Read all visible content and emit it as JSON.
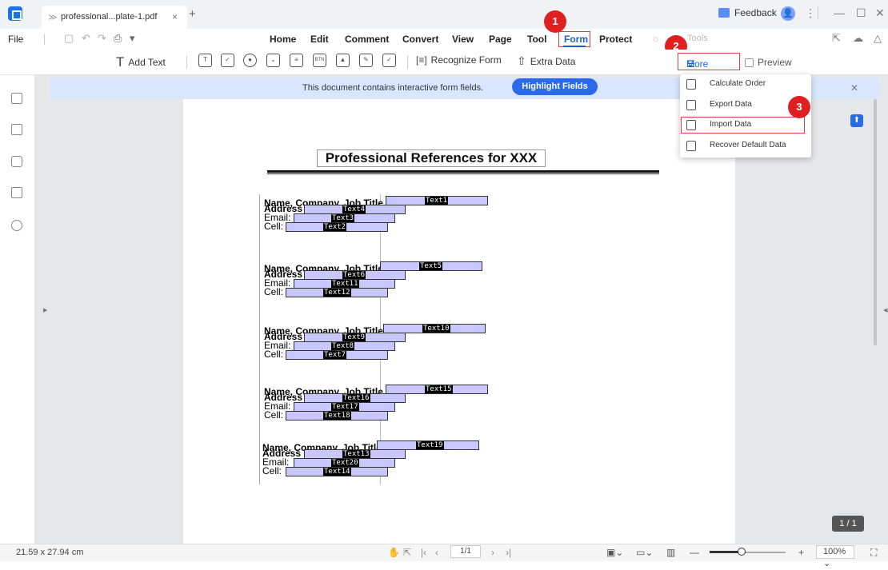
{
  "app": {
    "tab_title": "professional...plate-1.pdf",
    "feedback": "Feedback"
  },
  "menu": {
    "file": "File",
    "items": [
      "Home",
      "Edit",
      "Comment",
      "Convert",
      "View",
      "Page",
      "Tool",
      "Form",
      "Protect",
      "Tools"
    ],
    "active": "Form"
  },
  "toolbar": {
    "add_text": "Add Text",
    "recognize_form": "Recognize Form",
    "extra_data": "Extra Data",
    "more": "More",
    "preview": "Preview"
  },
  "dropdown": {
    "items": [
      "Calculate Order",
      "Export Data",
      "Import Data",
      "Recover Default Data"
    ]
  },
  "steps": [
    "1",
    "2",
    "3"
  ],
  "notification": {
    "message": "This document contains interactive form fields.",
    "button": "Highlight Fields"
  },
  "document": {
    "title": "Professional References for XXX",
    "labels": {
      "name": "Name, Company, Job Title",
      "address": "Address",
      "email": "Email:",
      "cell": "Cell:"
    },
    "blocks": [
      {
        "name": "Text1",
        "address": "Text4",
        "email": "Text3",
        "cell": "Text2"
      },
      {
        "name": "Text5",
        "address": "Text6",
        "email": "Text11",
        "cell": "Text12"
      },
      {
        "name": "Text10",
        "address": "Text9",
        "email": "Text8",
        "cell": "Text7"
      },
      {
        "name": "Text15",
        "address": "Text16",
        "email": "Text17",
        "cell": "Text18"
      },
      {
        "name": "Text19",
        "address": "Text13",
        "email": "Text20",
        "cell": "Text14"
      }
    ]
  },
  "page_indicator": "1 / 1",
  "status": {
    "page_size": "21.59 x 27.94 cm",
    "page": "1/1",
    "zoom": "100%"
  },
  "colors": {
    "accent": "#1a5fd6",
    "highlight": "#e43b3b",
    "field": "#c9c7ff",
    "notification_bg": "#d9e6ff"
  }
}
